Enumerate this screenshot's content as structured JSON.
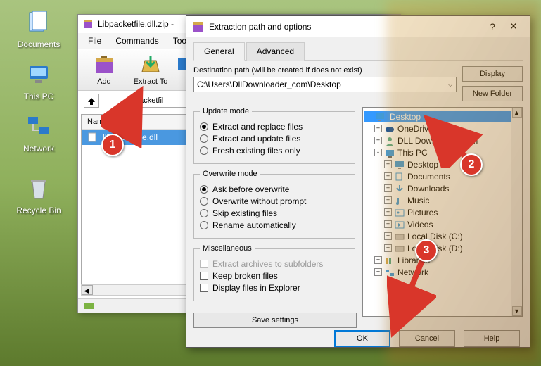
{
  "desktop": {
    "icons": [
      {
        "name": "documents-icon",
        "label": "Documents"
      },
      {
        "name": "this-pc-icon",
        "label": "This PC"
      },
      {
        "name": "network-icon",
        "label": "Network"
      },
      {
        "name": "recycle-bin-icon",
        "label": "Recycle Bin"
      }
    ]
  },
  "winrar": {
    "title": "Libpacketfile.dll.zip -",
    "menu": [
      "File",
      "Commands",
      "Tools"
    ],
    "tools": [
      {
        "name": "add-button",
        "label": "Add"
      },
      {
        "name": "extract-to-button",
        "label": "Extract To"
      }
    ],
    "path_input": "packetfil",
    "list_header": "Name",
    "file": "libpacketfile.dll"
  },
  "dialog": {
    "title": "Extraction path and options",
    "tabs": {
      "general": "General",
      "advanced": "Advanced",
      "active": "general"
    },
    "help_char": "?",
    "close_char": "✕",
    "dest_label": "Destination path (will be created if does not exist)",
    "dest_value": "C:\\Users\\DllDownloader_com\\Desktop",
    "display_btn": "Display",
    "newfolder_btn": "New Folder",
    "update_mode": {
      "legend": "Update mode",
      "options": [
        "Extract and replace files",
        "Extract and update files",
        "Fresh existing files only"
      ],
      "selected": 0
    },
    "overwrite_mode": {
      "legend": "Overwrite mode",
      "options": [
        "Ask before overwrite",
        "Overwrite without prompt",
        "Skip existing files",
        "Rename automatically"
      ],
      "selected": 0
    },
    "misc": {
      "legend": "Miscellaneous",
      "options": [
        "Extract archives to subfolders",
        "Keep broken files",
        "Display files in Explorer"
      ],
      "disabled": [
        true,
        false,
        false
      ]
    },
    "save_settings": "Save settings",
    "tree": [
      {
        "label": "Desktop",
        "indent": 0,
        "icon": "desktop",
        "exp": "-",
        "sel": true
      },
      {
        "label": "OneDrive",
        "indent": 1,
        "icon": "cloud",
        "exp": "+"
      },
      {
        "label": "DLL Downloader.com",
        "indent": 1,
        "icon": "user",
        "exp": "+"
      },
      {
        "label": "This PC",
        "indent": 1,
        "icon": "pc",
        "exp": "-"
      },
      {
        "label": "Desktop",
        "indent": 2,
        "icon": "desktop",
        "exp": "+"
      },
      {
        "label": "Documents",
        "indent": 2,
        "icon": "docs",
        "exp": "+"
      },
      {
        "label": "Downloads",
        "indent": 2,
        "icon": "down",
        "exp": "+"
      },
      {
        "label": "Music",
        "indent": 2,
        "icon": "music",
        "exp": "+"
      },
      {
        "label": "Pictures",
        "indent": 2,
        "icon": "pic",
        "exp": "+"
      },
      {
        "label": "Videos",
        "indent": 2,
        "icon": "video",
        "exp": "+"
      },
      {
        "label": "Local Disk (C:)",
        "indent": 2,
        "icon": "disk",
        "exp": "+"
      },
      {
        "label": "Local Disk (D:)",
        "indent": 2,
        "icon": "disk",
        "exp": "+"
      },
      {
        "label": "Libraries",
        "indent": 1,
        "icon": "lib",
        "exp": "+"
      },
      {
        "label": "Network",
        "indent": 1,
        "icon": "net",
        "exp": "+"
      }
    ],
    "footer": {
      "ok": "OK",
      "cancel": "Cancel",
      "help": "Help"
    }
  },
  "callouts": {
    "c1": "1",
    "c2": "2",
    "c3": "3"
  }
}
